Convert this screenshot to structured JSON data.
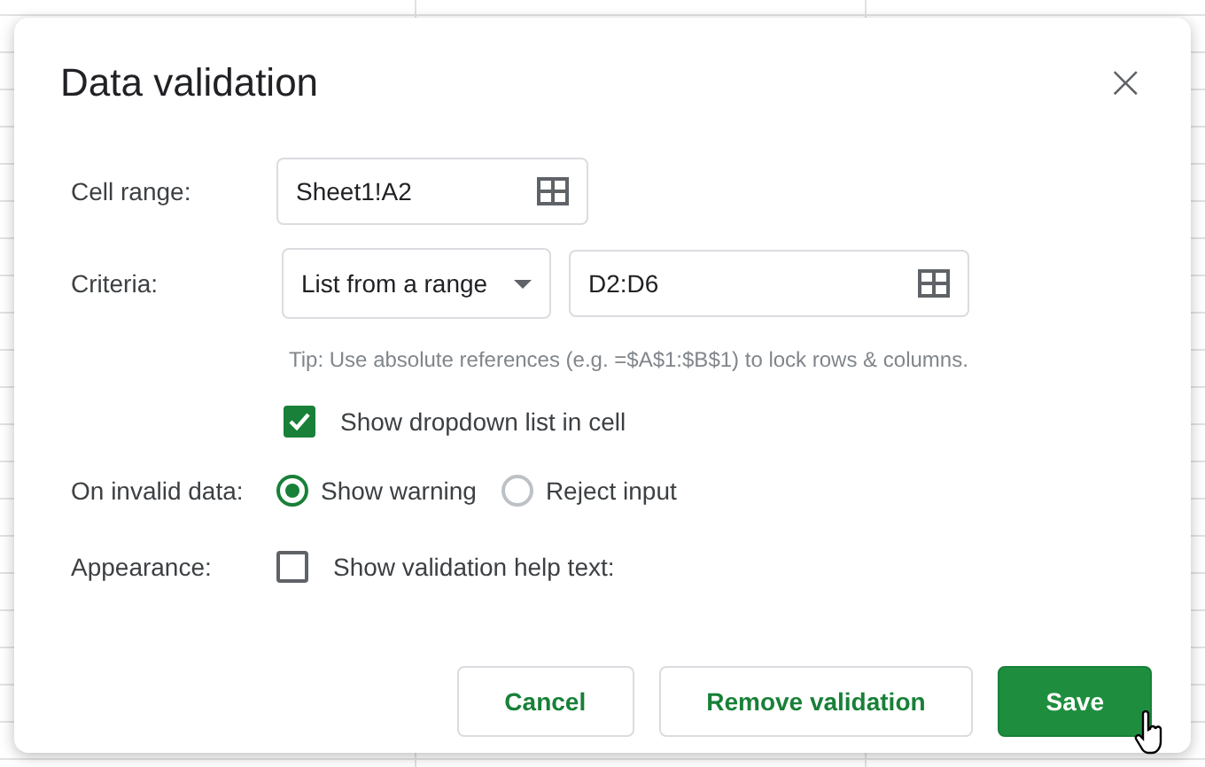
{
  "dialog": {
    "title": "Data validation",
    "close": "×"
  },
  "cell_range": {
    "label": "Cell range:",
    "value": "Sheet1!A2"
  },
  "criteria": {
    "label": "Criteria:",
    "type": "List from a range",
    "value": "D2:D6",
    "tip": "Tip: Use absolute references (e.g. =$A$1:$B$1) to lock rows & columns.",
    "show_dropdown": {
      "label": "Show dropdown list in cell",
      "checked": true
    }
  },
  "invalid_data": {
    "label": "On invalid data:",
    "options": [
      {
        "label": "Show warning",
        "selected": true
      },
      {
        "label": "Reject input",
        "selected": false
      }
    ]
  },
  "appearance": {
    "label": "Appearance:",
    "help_text": {
      "label": "Show validation help text:",
      "checked": false
    }
  },
  "buttons": [
    {
      "label": "Cancel",
      "kind": "secondary"
    },
    {
      "label": "Remove validation",
      "kind": "secondary"
    },
    {
      "label": "Save",
      "kind": "primary"
    }
  ]
}
